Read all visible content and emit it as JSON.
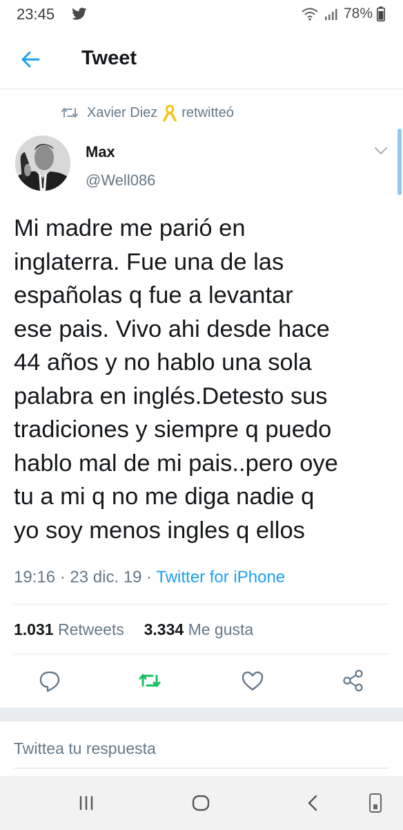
{
  "status": {
    "time": "23:45",
    "battery": "78%"
  },
  "header": {
    "title": "Tweet"
  },
  "retweet": {
    "user": "Xavier Diez",
    "action": "retwitteó"
  },
  "author": {
    "name": "Max",
    "handle": "@Well086"
  },
  "tweet": {
    "lines": [
      "Mi madre me parió en",
      "inglaterra. Fue una de las",
      "españolas q fue a levantar",
      "ese pais. Vivo ahi desde hace",
      "44 años y no hablo una sola",
      "palabra en inglés.Detesto sus",
      "tradiciones y siempre q puedo",
      "hablo mal de mi pais..pero oye",
      "tu a mi q no me diga nadie q",
      "yo soy menos ingles q ellos"
    ],
    "time": "19:16",
    "date": "23 dic. 19",
    "sep": "·",
    "source": "Twitter for iPhone"
  },
  "stats": {
    "retweets_count": "1.031",
    "retweets_label": "Retweets",
    "likes_count": "3.334",
    "likes_label": "Me gusta"
  },
  "reply": {
    "placeholder": "Twittea tu respuesta"
  },
  "icons": {
    "back": "arrow-left-icon",
    "retweet": "retweet-icon",
    "ribbon": "yellow-ribbon-icon",
    "chevron": "chevron-down-icon",
    "reply": "reply-icon",
    "like": "heart-icon",
    "share": "share-icon",
    "recent": "recent-apps-icon",
    "home": "home-icon",
    "nav_back": "nav-back-icon",
    "rotate": "screen-rotate-icon"
  },
  "colors": {
    "accent": "#1da1f2",
    "retweet_green": "#17bf63",
    "secondary": "#657786",
    "text": "#14171a",
    "ribbon": "#f5c518"
  }
}
